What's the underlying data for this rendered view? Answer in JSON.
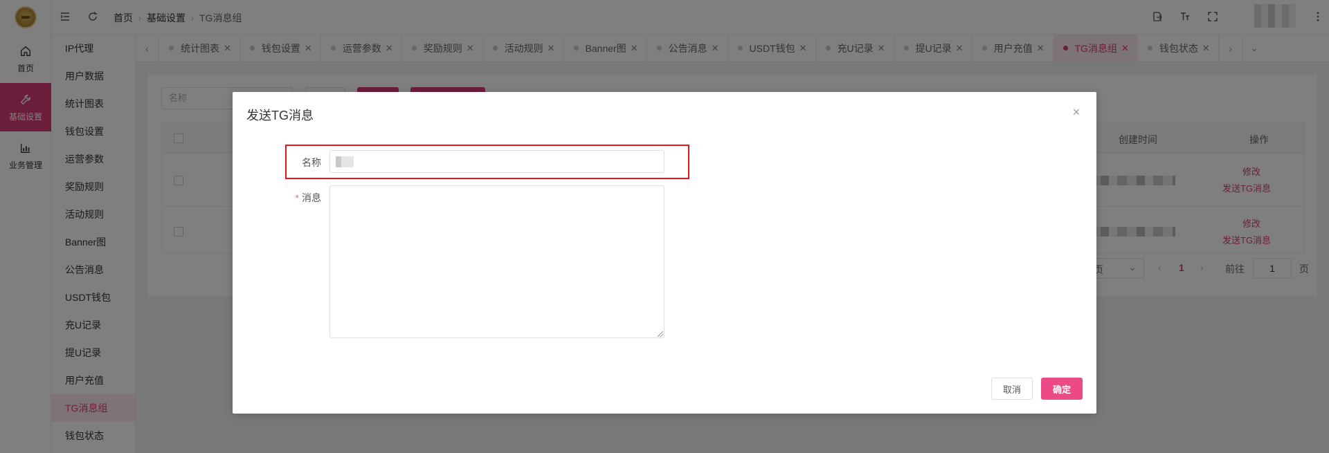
{
  "rail": {
    "items": [
      {
        "label": "首页",
        "icon": "home-icon"
      },
      {
        "label": "基础设置",
        "icon": "wrench-icon"
      },
      {
        "label": "业务管理",
        "icon": "bar-chart-icon"
      }
    ]
  },
  "header": {
    "breadcrumb": [
      "首页",
      "基础设置",
      "TG消息组"
    ],
    "icons": [
      "menu-fold-icon",
      "refresh-icon",
      "export-icon",
      "font-size-icon",
      "fullscreen-icon",
      "more-vertical-icon"
    ]
  },
  "submenu": {
    "items": [
      "IP代理",
      "用户数据",
      "统计图表",
      "钱包设置",
      "运营参数",
      "奖励规则",
      "活动规则",
      "Banner图",
      "公告消息",
      "USDT钱包",
      "充U记录",
      "提U记录",
      "用户充值",
      "TG消息组",
      "钱包状态"
    ],
    "active": "TG消息组"
  },
  "tabs": {
    "items": [
      "统计图表",
      "钱包设置",
      "运营参数",
      "奖励规则",
      "活动规则",
      "Banner图",
      "公告消息",
      "USDT钱包",
      "充U记录",
      "提U记录",
      "用户充值",
      "TG消息组",
      "钱包状态"
    ],
    "active": "TG消息组",
    "left_arrow": "‹",
    "right_arrow": "›",
    "dropdown": "⌄"
  },
  "list": {
    "search_placeholder": "名称",
    "col_created": "创建时间",
    "col_actions": "操作",
    "rows": [
      {
        "edit": "修改",
        "send": "发送TG消息"
      },
      {
        "edit": "修改",
        "send": "发送TG消息"
      }
    ],
    "pager": {
      "size_suffix": "页",
      "current": "1",
      "goto_label": "前往",
      "goto_value": "1",
      "page_unit": "页",
      "prev": "‹",
      "next": "›"
    }
  },
  "dialog": {
    "title": "发送TG消息",
    "close": "×",
    "name_label": "名称",
    "message_label": "消息",
    "required_mark": "*",
    "cancel": "取消",
    "confirm": "确定"
  },
  "colors": {
    "accent": "#d63d79",
    "confirm_button": "#ec4a87",
    "highlight_box": "#e0161d"
  }
}
